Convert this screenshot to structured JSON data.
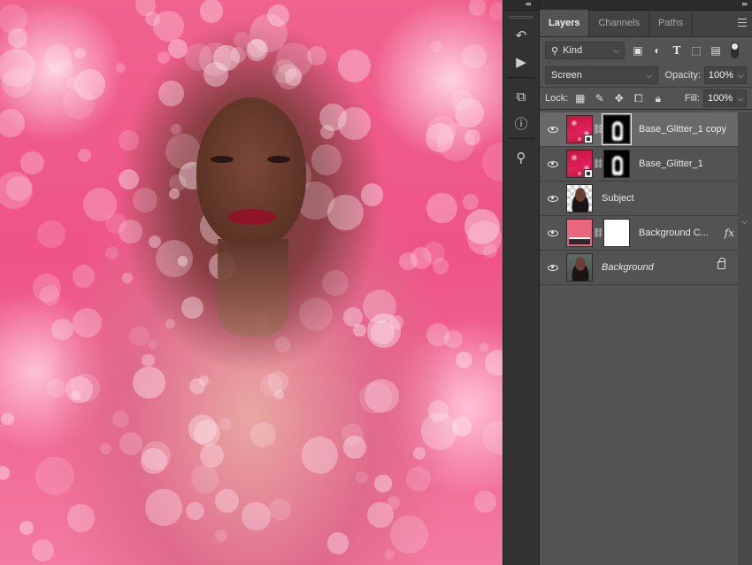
{
  "canvas": {
    "description_icon": "document-canvas"
  },
  "side_strip": {
    "tools": [
      {
        "icon": "history-icon",
        "glyph": "↶"
      },
      {
        "icon": "play-icon",
        "glyph": "▶"
      },
      {
        "icon": "3d-layers-icon",
        "glyph": "⧉"
      },
      {
        "icon": "info-icon",
        "glyph": "ⓘ"
      },
      {
        "icon": "clone-source-icon",
        "glyph": "⚲"
      }
    ],
    "collapse_glyph": "◂◂"
  },
  "panel": {
    "collapse_glyph": "▸▸",
    "tabs": [
      {
        "label": "Layers",
        "active": true
      },
      {
        "label": "Channels",
        "active": false
      },
      {
        "label": "Paths",
        "active": false
      }
    ],
    "filter": {
      "kind_label": "Kind",
      "icons": [
        "image-filter-icon",
        "adjustment-filter-icon",
        "type-filter-icon",
        "shape-filter-icon",
        "smart-object-filter-icon"
      ]
    },
    "blend_mode": "Screen",
    "opacity_label": "Opacity:",
    "opacity_value": "100%",
    "lock_label": "Lock:",
    "fill_label": "Fill:",
    "fill_value": "100%",
    "layers": [
      {
        "name": "Base_Glitter_1 copy",
        "selected": true,
        "thumb": "glitter",
        "mask": "shape",
        "smart": true,
        "italic": false
      },
      {
        "name": "Base_Glitter_1",
        "selected": false,
        "thumb": "glitter",
        "mask": "shape",
        "smart": true,
        "italic": false
      },
      {
        "name": "Subject",
        "selected": false,
        "thumb": "subject",
        "mask": null,
        "smart": false,
        "italic": false
      },
      {
        "name": "Background C...",
        "selected": false,
        "thumb": "fill",
        "mask": "white",
        "smart": false,
        "italic": false,
        "fx": "fx"
      },
      {
        "name": "Background",
        "selected": false,
        "thumb": "bg",
        "mask": null,
        "smart": false,
        "italic": true,
        "locked": true
      }
    ]
  },
  "colors": {
    "panel_bg": "#535353",
    "selected_layer": "#696969",
    "fill_layer_color": "#e8677d"
  }
}
